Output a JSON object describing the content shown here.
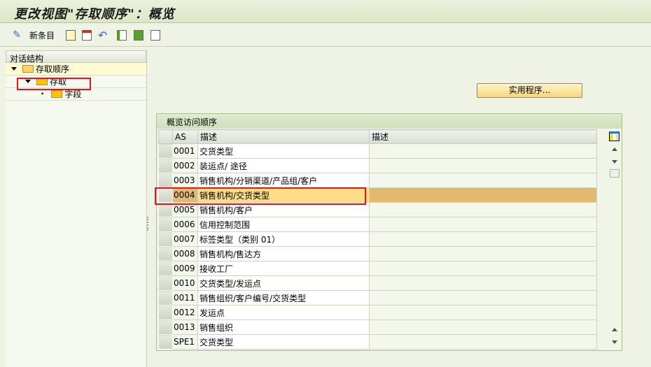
{
  "window": {
    "title": "更改视图\"存取顺序\"：概览"
  },
  "toolbar": {
    "new_entries_label": "新条目",
    "icons": [
      "glasses-pencil-icon",
      "copy-icon",
      "delete-icon",
      "undo-icon",
      "select-all-icon",
      "select-block-icon",
      "deselect-all-icon"
    ]
  },
  "tree": {
    "header": "对话结构",
    "nodes": [
      {
        "label": "存取顺序",
        "level": 0,
        "expanded": true,
        "selected": true
      },
      {
        "label": "存取",
        "level": 1,
        "expanded": true
      },
      {
        "label": "字段",
        "level": 2
      }
    ]
  },
  "util_button": "实用程序...",
  "table": {
    "title": "概览访问顺序",
    "columns": [
      "AS",
      "描述",
      "描述"
    ],
    "rows": [
      [
        "0001",
        "交货类型",
        ""
      ],
      [
        "0002",
        "装运点/ 途径",
        ""
      ],
      [
        "0003",
        "销售机构/分销渠道/产品组/客户",
        ""
      ],
      [
        "0004",
        "销售机构/交货类型",
        ""
      ],
      [
        "0005",
        "销售机构/客户",
        ""
      ],
      [
        "0006",
        "信用控制范围",
        ""
      ],
      [
        "0007",
        "标签类型（类别 01）",
        ""
      ],
      [
        "0008",
        "销售机构/售达方",
        ""
      ],
      [
        "0009",
        "接收工厂",
        ""
      ],
      [
        "0010",
        "交货类型/发运点",
        ""
      ],
      [
        "0011",
        "销售组织/客户编号/交货类型",
        ""
      ],
      [
        "0012",
        "发运点",
        ""
      ],
      [
        "0013",
        "销售组织",
        ""
      ],
      [
        "SPE1",
        "交货类型",
        ""
      ]
    ],
    "highlighted_row": "0004"
  },
  "colors": {
    "highlight": "#fcdc86",
    "annotation": "#e8141a"
  }
}
